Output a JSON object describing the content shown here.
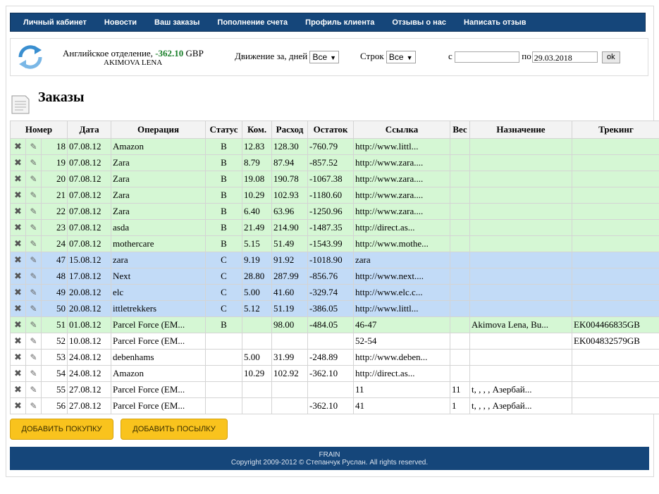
{
  "nav": [
    "Личный кабинет",
    "Новости",
    "Ваш заказы",
    "Пополнение счета",
    "Профиль клиента",
    "Отзывы о нас",
    "Написать отзыв"
  ],
  "account": {
    "department": "Английское отделение, ",
    "balance": "-362.10",
    "currency": " GBP",
    "name": "AKIMOVA LENA"
  },
  "filters": {
    "days_label": "Движение за, дней",
    "days_value": "Все",
    "rows_label": "Строк",
    "rows_value": "Все",
    "from_label": "с",
    "from_value": "",
    "to_label": "по",
    "to_value": "29.03.2018",
    "ok_label": "ok"
  },
  "page_title": "Заказы",
  "icons": {
    "delete": "close-x-icon",
    "edit": "pencil-icon",
    "logo": "refresh-arrows-icon",
    "title": "document-icon"
  },
  "colors": {
    "nav": "#15467a",
    "green_row": "#d5f7d4",
    "blue_row": "#c2dbf7",
    "button": "#f9c31d",
    "balance": "#1a7f2a"
  },
  "table": {
    "headers": [
      "Номер",
      "Дата",
      "Операция",
      "Статус",
      "Ком.",
      "Расход",
      "Остаток",
      "Ссылка",
      "Вес",
      "Назначение",
      "Трекинг"
    ],
    "rows": [
      {
        "style": "green",
        "num": "18",
        "date": "07.08.12",
        "op": "Amazon",
        "status": "B",
        "com": "12.83",
        "exp": "128.30",
        "bal": "-760.79",
        "link": "http://www.littl...",
        "weight": "",
        "dest": "",
        "track": ""
      },
      {
        "style": "green",
        "num": "19",
        "date": "07.08.12",
        "op": "Zara",
        "status": "B",
        "com": "8.79",
        "exp": "87.94",
        "bal": "-857.52",
        "link": "http://www.zara....",
        "weight": "",
        "dest": "",
        "track": ""
      },
      {
        "style": "green",
        "num": "20",
        "date": "07.08.12",
        "op": "Zara",
        "status": "B",
        "com": "19.08",
        "exp": "190.78",
        "bal": "-1067.38",
        "link": "http://www.zara....",
        "weight": "",
        "dest": "",
        "track": ""
      },
      {
        "style": "green",
        "num": "21",
        "date": "07.08.12",
        "op": "Zara",
        "status": "B",
        "com": "10.29",
        "exp": "102.93",
        "bal": "-1180.60",
        "link": "http://www.zara....",
        "weight": "",
        "dest": "",
        "track": ""
      },
      {
        "style": "green",
        "num": "22",
        "date": "07.08.12",
        "op": "Zara",
        "status": "B",
        "com": "6.40",
        "exp": "63.96",
        "bal": "-1250.96",
        "link": "http://www.zara....",
        "weight": "",
        "dest": "",
        "track": ""
      },
      {
        "style": "green",
        "num": "23",
        "date": "07.08.12",
        "op": "asda",
        "status": "B",
        "com": "21.49",
        "exp": "214.90",
        "bal": "-1487.35",
        "link": "http://direct.as...",
        "weight": "",
        "dest": "",
        "track": ""
      },
      {
        "style": "green",
        "num": "24",
        "date": "07.08.12",
        "op": "mothercare",
        "status": "B",
        "com": "5.15",
        "exp": "51.49",
        "bal": "-1543.99",
        "link": "http://www.mothe...",
        "weight": "",
        "dest": "",
        "track": ""
      },
      {
        "style": "blue",
        "num": "47",
        "date": "15.08.12",
        "op": "zara",
        "status": "C",
        "com": "9.19",
        "exp": "91.92",
        "bal": "-1018.90",
        "link": "zara",
        "weight": "",
        "dest": "",
        "track": ""
      },
      {
        "style": "blue",
        "num": "48",
        "date": "17.08.12",
        "op": "Next",
        "status": "C",
        "com": "28.80",
        "exp": "287.99",
        "bal": "-856.76",
        "link": "http://www.next....",
        "weight": "",
        "dest": "",
        "track": ""
      },
      {
        "style": "blue",
        "num": "49",
        "date": "20.08.12",
        "op": "elc",
        "status": "C",
        "com": "5.00",
        "exp": "41.60",
        "bal": "-329.74",
        "link": "http://www.elc.c...",
        "weight": "",
        "dest": "",
        "track": ""
      },
      {
        "style": "blue",
        "num": "50",
        "date": "20.08.12",
        "op": "ittletrekkers",
        "status": "C",
        "com": "5.12",
        "exp": "51.19",
        "bal": "-386.05",
        "link": "http://www.littl...",
        "weight": "",
        "dest": "",
        "track": ""
      },
      {
        "style": "green",
        "num": "51",
        "date": "01.08.12",
        "op": "Parcel Force (EM...",
        "status": "B",
        "com": "",
        "exp": "98.00",
        "bal": "-484.05",
        "link": "46-47",
        "weight": "",
        "dest": "Akimova Lena, Bu...",
        "track": "EK004466835GB"
      },
      {
        "style": "white",
        "num": "52",
        "date": "10.08.12",
        "op": "Parcel Force (EM...",
        "status": "",
        "com": "",
        "exp": "",
        "bal": "",
        "link": "52-54",
        "weight": "",
        "dest": "",
        "track": "EK004832579GB"
      },
      {
        "style": "white",
        "num": "53",
        "date": "24.08.12",
        "op": "debenhams",
        "status": "",
        "com": "5.00",
        "exp": "31.99",
        "bal": "-248.89",
        "link": "http://www.deben...",
        "weight": "",
        "dest": "",
        "track": ""
      },
      {
        "style": "white",
        "num": "54",
        "date": "24.08.12",
        "op": "Amazon",
        "status": "",
        "com": "10.29",
        "exp": "102.92",
        "bal": "-362.10",
        "link": "http://direct.as...",
        "weight": "",
        "dest": "",
        "track": ""
      },
      {
        "style": "white",
        "num": "55",
        "date": "27.08.12",
        "op": "Parcel Force (EM...",
        "status": "",
        "com": "",
        "exp": "",
        "bal": "",
        "link": "11",
        "weight": "11",
        "dest": "t, , , , Азербай...",
        "track": ""
      },
      {
        "style": "white",
        "num": "56",
        "date": "27.08.12",
        "op": "Parcel Force (EM...",
        "status": "",
        "com": "",
        "exp": "",
        "bal": "-362.10",
        "link": "41",
        "weight": "1",
        "dest": "t, , , , Азербай...",
        "track": ""
      }
    ]
  },
  "buttons": {
    "add_purchase": "ДОБАВИТЬ ПОКУПКУ",
    "add_parcel": "ДОБАВИТЬ ПОСЫЛКУ"
  },
  "footer": {
    "line1": "FRAIN",
    "line2": "Copyright 2009-2012 © Степанчук Руслан. All rights reserved."
  }
}
